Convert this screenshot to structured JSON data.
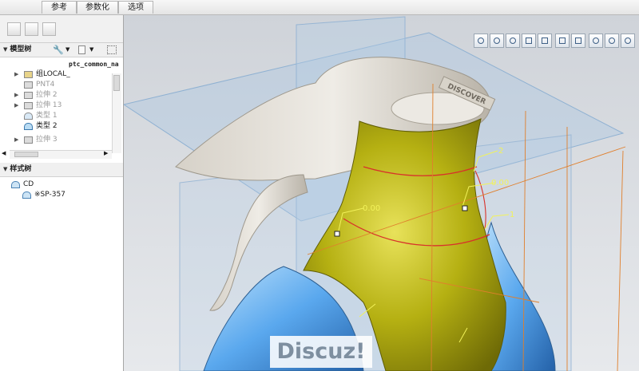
{
  "top_tabs": [
    "参考",
    "参数化",
    "选项"
  ],
  "model_tree": {
    "header": "模型树",
    "column_header": "ptc_common_na",
    "items": [
      {
        "label": "组LOCAL_",
        "expand": "▶",
        "dim": false
      },
      {
        "label": "PNT4",
        "expand": "",
        "dim": true
      },
      {
        "label": "拉伸 2",
        "expand": "▶",
        "dim": true
      },
      {
        "label": "拉伸 13",
        "expand": "▶",
        "dim": true
      },
      {
        "label": "类型 1",
        "expand": "",
        "dim": true
      },
      {
        "label": "类型 2",
        "expand": "",
        "dim": false
      },
      {
        "label": "拉伸 3",
        "expand": "▶",
        "dim": true
      }
    ]
  },
  "style_tree": {
    "header": "样式树",
    "items": [
      "CD",
      "※SP-357"
    ]
  },
  "viewport": {
    "dimension_labels": [
      "2",
      "0.00",
      "0.00",
      "1"
    ],
    "part_stamp": "DISCOVER",
    "surface_color": "#b5b012",
    "body_color": "#3d8fd8"
  },
  "view_toolbar_icons": [
    "refit-icon",
    "zoom-in-icon",
    "zoom-out-icon",
    "repaint-icon",
    "display-style-icon",
    "saved-views-icon",
    "layers-icon",
    "datum-display-icon",
    "spin-center-icon",
    "annotation-icon"
  ],
  "watermark": "Discuz!"
}
